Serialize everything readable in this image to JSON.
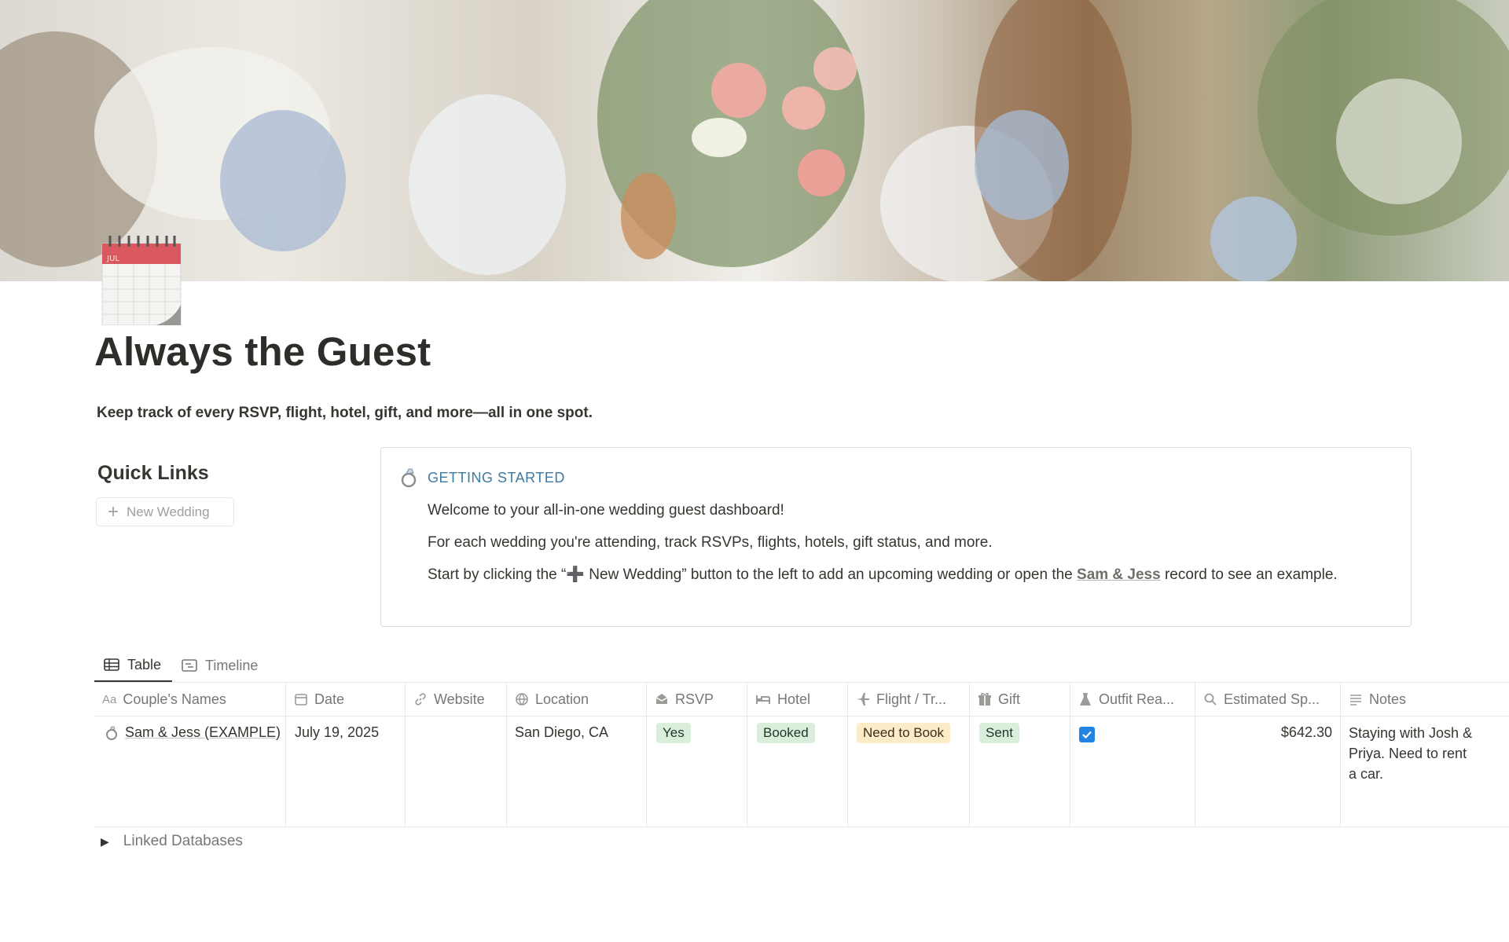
{
  "page": {
    "title": "Always the Guest",
    "subtitle": "Keep track of every RSVP, flight, hotel, gift, and more—all in one spot.",
    "icon": "calendar-icon",
    "icon_month": "JUL"
  },
  "quick_links": {
    "heading": "Quick Links",
    "new_wedding_label": "New Wedding"
  },
  "callout": {
    "icon": "ring-icon",
    "title": "GETTING STARTED",
    "line1": "Welcome to your all-in-one wedding guest dashboard!",
    "line2": "For each wedding you're attending, track RSVPs, flights, hotels, gift status, and more.",
    "line3_before": "Start by clicking the “➕ New Wedding” button to the left to add an upcoming wedding or open the",
    "line3_link": "Sam & Jess",
    "line3_after": "record to see",
    "line3_cont": "an example."
  },
  "views": {
    "tabs": [
      {
        "label": "Table",
        "icon": "table-icon",
        "active": true
      },
      {
        "label": "Timeline",
        "icon": "timeline-icon",
        "active": false
      }
    ]
  },
  "table": {
    "columns": [
      {
        "label": "Couple's Names",
        "icon": "title-icon"
      },
      {
        "label": "Date",
        "icon": "calendar-small-icon"
      },
      {
        "label": "Website",
        "icon": "link-icon"
      },
      {
        "label": "Location",
        "icon": "globe-icon"
      },
      {
        "label": "RSVP",
        "icon": "envelope-icon"
      },
      {
        "label": "Hotel",
        "icon": "bed-icon"
      },
      {
        "label": "Flight / Tr...",
        "icon": "plane-icon"
      },
      {
        "label": "Gift",
        "icon": "gift-icon"
      },
      {
        "label": "Outfit Rea...",
        "icon": "dress-icon"
      },
      {
        "label": "Estimated Sp...",
        "icon": "search-icon"
      },
      {
        "label": "Notes",
        "icon": "notes-icon"
      }
    ],
    "rows": [
      {
        "name": "Sam & Jess (EXAMPLE)",
        "date": "July 19, 2025",
        "website": "",
        "location": "San Diego, CA",
        "rsvp": "Yes",
        "hotel": "Booked",
        "flight": "Need to Book",
        "gift": "Sent",
        "outfit_ready": true,
        "estimated_spend": "$642.30",
        "notes": "Staying with Josh & Priya. Need to rent a car."
      }
    ]
  },
  "toggle": {
    "label": "Linked Databases"
  },
  "colors": {
    "accent": "#2383e2",
    "callout_title": "#3e7aa0",
    "green_tag_bg": "#dbeddb",
    "yellow_tag_bg": "#fdecc8"
  }
}
